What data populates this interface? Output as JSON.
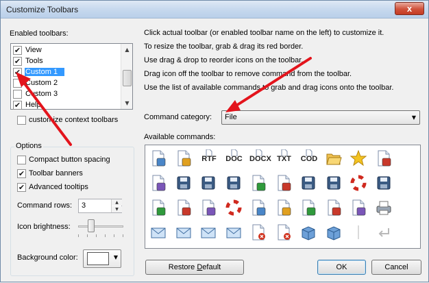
{
  "window": {
    "title": "Customize Toolbars",
    "close_glyph": "x"
  },
  "left": {
    "enabled_label": "Enabled toolbars:",
    "toolbars": [
      {
        "label": "View",
        "checked": true,
        "selected": false
      },
      {
        "label": "Tools",
        "checked": true,
        "selected": false
      },
      {
        "label": "Custom 1",
        "checked": true,
        "selected": true
      },
      {
        "label": "Custom 2",
        "checked": false,
        "selected": false
      },
      {
        "label": "Custom 3",
        "checked": false,
        "selected": false
      },
      {
        "label": "Help",
        "checked": true,
        "selected": false
      }
    ],
    "context_toolbars": {
      "label": "customize context toolbars",
      "checked": false
    }
  },
  "options": {
    "legend": "Options",
    "compact": {
      "label": "Compact button spacing",
      "checked": false
    },
    "banners": {
      "label": "Toolbar banners",
      "checked": true
    },
    "tooltips": {
      "label": "Advanced tooltips",
      "checked": true
    },
    "command_rows_label": "Command rows:",
    "command_rows_value": "3",
    "icon_brightness_label": "Icon brightness:",
    "background_color_label": "Background color:",
    "background_color": "#ffffff"
  },
  "instructions": [
    "Click actual toolbar (or enabled toolbar name on the left) to customize it.",
    "To resize the toolbar, grab & drag its red border.",
    "Use drag & drop to reorder icons on the toolbar.",
    "Drag icon off the toolbar to remove command from the toolbar.",
    "Use the list of available commands to grab and drag icons onto the toolbar."
  ],
  "category": {
    "label": "Command category:",
    "value": "File"
  },
  "available_label": "Available commands:",
  "commands": [
    {
      "name": "new-document-icon",
      "text": ""
    },
    {
      "name": "copy-document-icon",
      "text": ""
    },
    {
      "name": "rtf-icon",
      "text": "RTF"
    },
    {
      "name": "doc-icon",
      "text": "DOC"
    },
    {
      "name": "docx-icon",
      "text": "DOCX"
    },
    {
      "name": "txt-icon",
      "text": "TXT"
    },
    {
      "name": "cod-icon",
      "text": "COD"
    },
    {
      "name": "open-folder-icon",
      "text": ""
    },
    {
      "name": "star-icon",
      "text": ""
    },
    {
      "name": "wrench-star-icon",
      "text": ""
    },
    {
      "name": "colored-docs-icon",
      "text": ""
    },
    {
      "name": "save-icon",
      "text": ""
    },
    {
      "name": "save-as-icon",
      "text": ""
    },
    {
      "name": "save-multiple-icon",
      "text": ""
    },
    {
      "name": "green-doc-icon",
      "text": ""
    },
    {
      "name": "save-web-icon",
      "text": ""
    },
    {
      "name": "save-picture-icon",
      "text": ""
    },
    {
      "name": "save-copy-icon",
      "text": ""
    },
    {
      "name": "lifebuoy-save-icon",
      "text": ""
    },
    {
      "name": "network-save-icon",
      "text": ""
    },
    {
      "name": "network-user-icon",
      "text": ""
    },
    {
      "name": "green-arrows-doc-icon",
      "text": ""
    },
    {
      "name": "search-doc-icon",
      "text": ""
    },
    {
      "name": "lifebuoy-icon",
      "text": ""
    },
    {
      "name": "page-layout-icon",
      "text": ""
    },
    {
      "name": "edit-doc-icon",
      "text": ""
    },
    {
      "name": "revert-doc-icon",
      "text": ""
    },
    {
      "name": "doc-list-icon",
      "text": ""
    },
    {
      "name": "print-preview-icon",
      "text": ""
    },
    {
      "name": "printer-icon",
      "text": ""
    },
    {
      "name": "email-icon",
      "text": ""
    },
    {
      "name": "email-user-icon",
      "text": ""
    },
    {
      "name": "email-doc-icon",
      "text": ""
    },
    {
      "name": "send-network-icon",
      "text": ""
    },
    {
      "name": "delete-doc-icon",
      "text": ""
    },
    {
      "name": "delete-copy-icon",
      "text": ""
    },
    {
      "name": "package-star-icon",
      "text": ""
    },
    {
      "name": "package-icon",
      "text": ""
    },
    {
      "name": "separator-icon",
      "text": ""
    },
    {
      "name": "return-arrow-icon",
      "text": ""
    }
  ],
  "buttons": {
    "restore": "Restore Default",
    "ok": "OK",
    "cancel": "Cancel"
  },
  "colors": {
    "selection": "#3399ff",
    "annotation_arrow": "#e3141c"
  }
}
